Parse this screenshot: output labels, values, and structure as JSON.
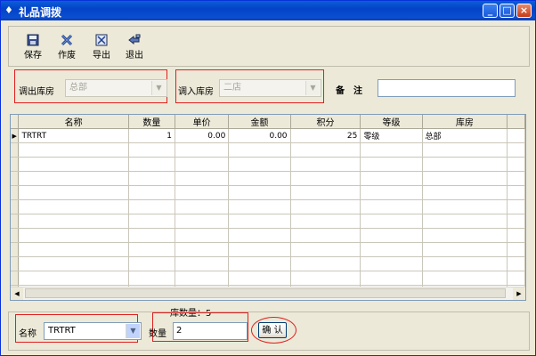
{
  "window": {
    "title": "礼品调拨",
    "title_icon": "window-menu-icon",
    "controls": [
      "minimize",
      "maximize",
      "close"
    ]
  },
  "toolbar": {
    "buttons": [
      {
        "label": "保存",
        "icon": "save-icon"
      },
      {
        "label": "作废",
        "icon": "void-icon"
      },
      {
        "label": "导出",
        "icon": "export-icon"
      },
      {
        "label": "退出",
        "icon": "exit-icon"
      }
    ]
  },
  "filters": {
    "out_warehouse_label": "调出库房",
    "out_warehouse_value": "总部",
    "in_warehouse_label": "调入库房",
    "in_warehouse_value": "二店",
    "remark_label": "备　注",
    "remark_value": ""
  },
  "grid": {
    "columns": [
      "名称",
      "数量",
      "单价",
      "金额",
      "积分",
      "等级",
      "库房"
    ],
    "rows": [
      {
        "name": "TRTRT",
        "qty": "1",
        "price": "0.00",
        "amount": "0.00",
        "points": "25",
        "level": "零级",
        "warehouse": "总部"
      }
    ],
    "current_row_marker": "▶"
  },
  "stock": {
    "label": "库数量：",
    "value": "5"
  },
  "entry": {
    "name_label": "名称",
    "name_value": "TRTRT",
    "qty_label": "数量",
    "qty_value": "2",
    "confirm_label": "确 认"
  },
  "colors": {
    "titlebar": "#0343c8",
    "window_bg": "#ece9d8",
    "highlight_red": "#e02020",
    "border_blue": "#7f9db9"
  }
}
